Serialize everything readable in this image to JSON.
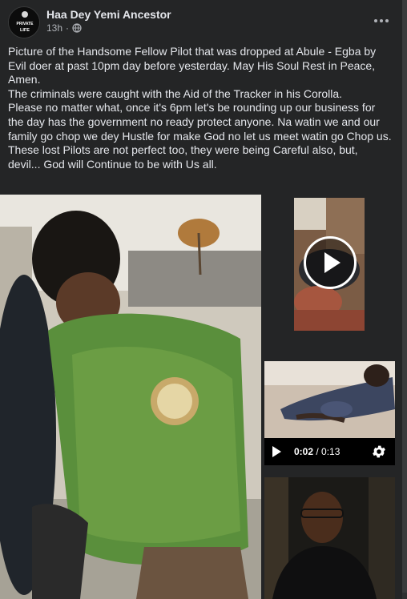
{
  "post": {
    "author": "Haa Dey Yemi Ancestor",
    "time": "13h",
    "separator": "·",
    "avatar_text_top": "PRIVATE",
    "avatar_text_bottom": "LIFE",
    "privacy_icon": "globe-icon",
    "more_icon": "more-options-icon",
    "paragraphs": [
      "Picture of the Handsome Fellow Pilot that was dropped at Abule - Egba by Evil doer at past 10pm day before yesterday. May His Soul Rest in Peace, Amen.",
      "The criminals were caught with the Aid of the Tracker in his Corolla.",
      "Please no matter what, once it's 6pm let's be rounding up our business for the day has the government no ready protect anyone. Na watin we and our family go chop we dey Hustle for make God no let us meet watin go Chop us.",
      "These lost Pilots are not perfect too, they were being Careful also, but, devil... God will Continue to be with Us all."
    ]
  },
  "media": {
    "video_time_current": "0:02",
    "video_time_sep": " / ",
    "video_time_total": "0:13",
    "play_icon": "play-icon",
    "settings_icon": "gear-icon"
  },
  "colors": {
    "background": "#242526",
    "text": "#e4e6eb",
    "secondary_text": "#b0b3b8"
  }
}
